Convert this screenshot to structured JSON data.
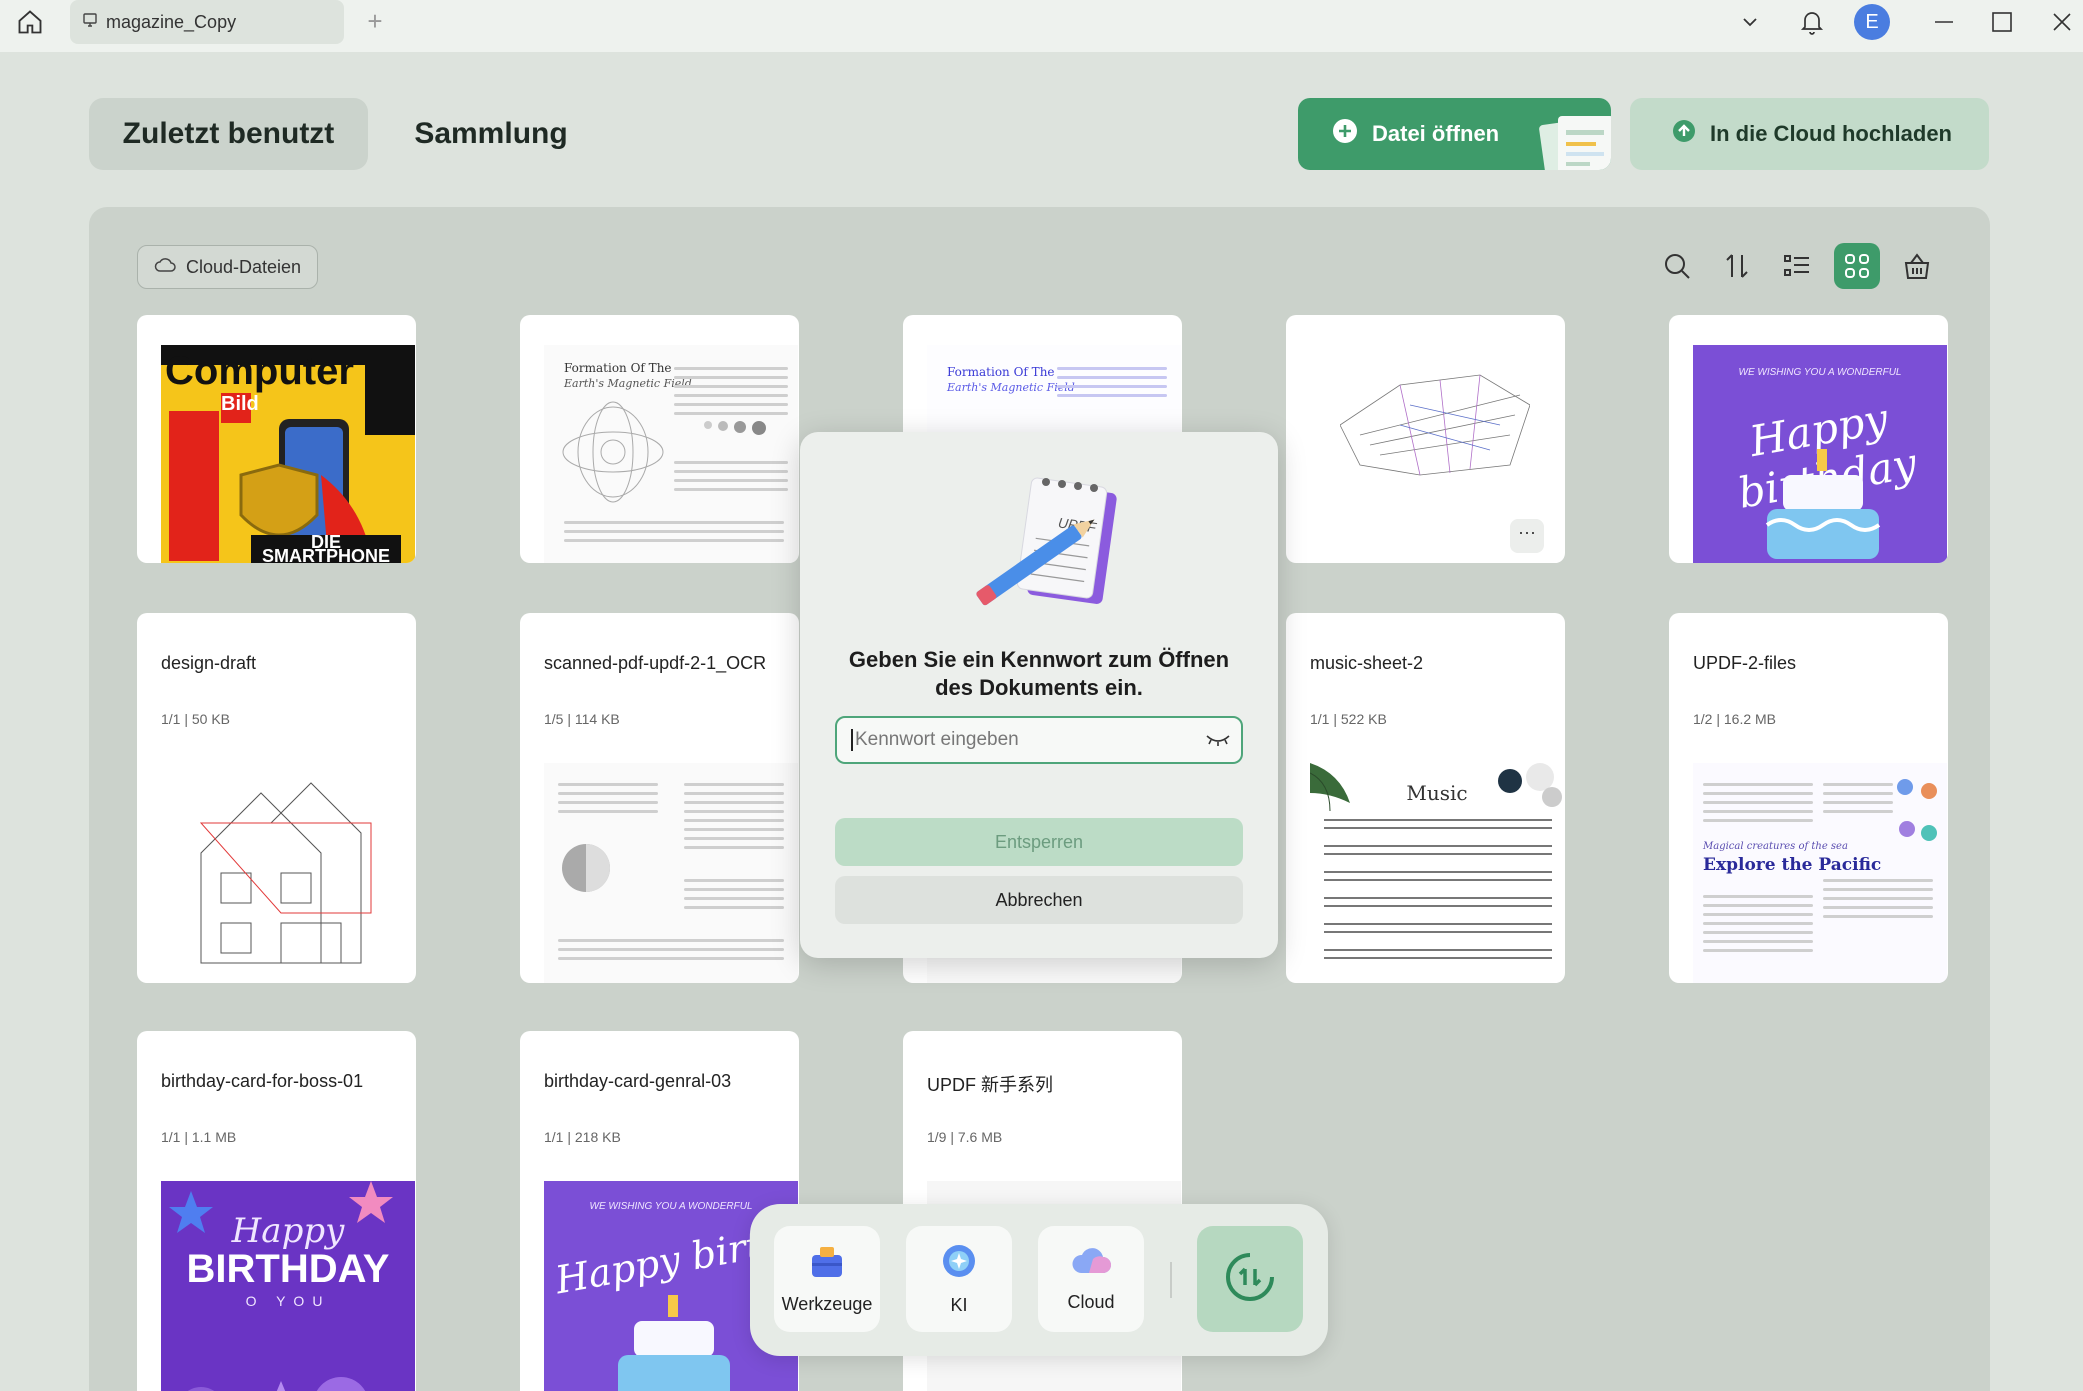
{
  "titlebar": {
    "tab_label": "magazine_Copy",
    "avatar_letter": "E"
  },
  "nav": {
    "recent": "Zuletzt benutzt",
    "collection": "Sammlung",
    "open_file": "Datei öffnen",
    "upload_cloud": "In die Cloud hochladen"
  },
  "panel": {
    "cloud_files": "Cloud-Dateien"
  },
  "thumbs_row1": {
    "computer_bild": {
      "title": "Computer",
      "bild": "Bild",
      "footer": "DIE SMARTPHONE"
    },
    "magnetic1": {
      "title": "Formation Of The",
      "subtitle": "Earth's Magnetic Field"
    },
    "magnetic2": {
      "title": "Formation Of The",
      "subtitle": "Earth's Magnetic Field"
    },
    "birthday_top": {
      "small": "WE WISHING YOU A WONDERFUL",
      "script": "Happy birthday"
    },
    "more": "···"
  },
  "files": [
    {
      "title": "design-draft",
      "meta": "1/1 | 50 KB"
    },
    {
      "title": "scanned-pdf-updf-2-1_OCR",
      "meta": "1/5 | 114 KB"
    },
    {
      "title": "music-sheet-2",
      "meta": "1/1 | 522 KB",
      "thumb_text": "Music"
    },
    {
      "title": "UPDF-2-files",
      "meta": "1/2 | 16.2 MB",
      "thumb_small": "Magical creatures of the sea",
      "thumb_heading": "Explore the Pacific"
    },
    {
      "title": "birthday-card-for-boss-01",
      "meta": "1/1 | 1.1 MB",
      "thumb_script": "Happy",
      "thumb_big": "BIRTHDAY",
      "thumb_small": "O YOU"
    },
    {
      "title": "birthday-card-genral-03",
      "meta": "1/1 | 218 KB",
      "thumb_small": "WE WISHING YOU A WONDERFUL",
      "thumb_script": "Happy birthd"
    },
    {
      "title": "UPDF 新手系列",
      "meta": "1/9 | 7.6 MB"
    }
  ],
  "dialog": {
    "notepad_text": "UPDF",
    "title": "Geben Sie ein Kennwort zum Öffnen des Dokuments ein.",
    "placeholder": "Kennwort eingeben",
    "unlock": "Entsperren",
    "cancel": "Abbrechen"
  },
  "dock": {
    "tools": "Werkzeuge",
    "ai": "KI",
    "cloud": "Cloud"
  },
  "colors": {
    "accent": "#3e9b6a",
    "background": "#dde3dd",
    "panel": "#cbd2cb"
  }
}
